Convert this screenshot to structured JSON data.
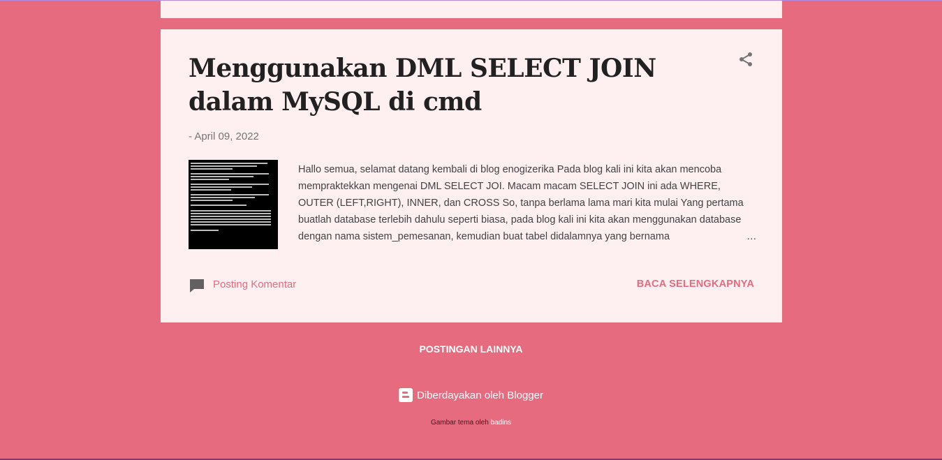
{
  "post": {
    "title": "Menggunakan DML SELECT JOIN dalam MySQL di cmd",
    "date": "- April 09, 2022",
    "snippet": "  Hallo semua, selamat datang kembali di blog enogizerika Pada blog kali ini kita akan mencoba mempraktekkan mengenai DML SELECT JOI. Macam macam SELECT JOIN ini ada WHERE, OUTER (LEFT,RIGHT), INNER, dan CROSS So, tanpa berlama lama mari kita mulai Yang pertama buatlah database terlebih dahulu seperti biasa, pada blog kali ini kita akan menggunakan database dengan nama sistem_pemesanan, kemudian buat tabel didalamnya yang bernama",
    "ellipsis": "…",
    "comment_label": "Posting Komentar",
    "read_more_label": "BACA SELENGKAPNYA",
    "share_icon": "share-icon",
    "comment_icon": "comment-icon"
  },
  "footer": {
    "more_posts_label": "POSTINGAN LAINNYA",
    "powered_by_label": "Diberdayakan oleh Blogger",
    "credit_prefix": "Gambar tema oleh ",
    "credit_author": "badins"
  },
  "colors": {
    "background": "#e76b7f",
    "card": "#fef0f1",
    "accent": "#e76b7f",
    "title": "#212121"
  }
}
